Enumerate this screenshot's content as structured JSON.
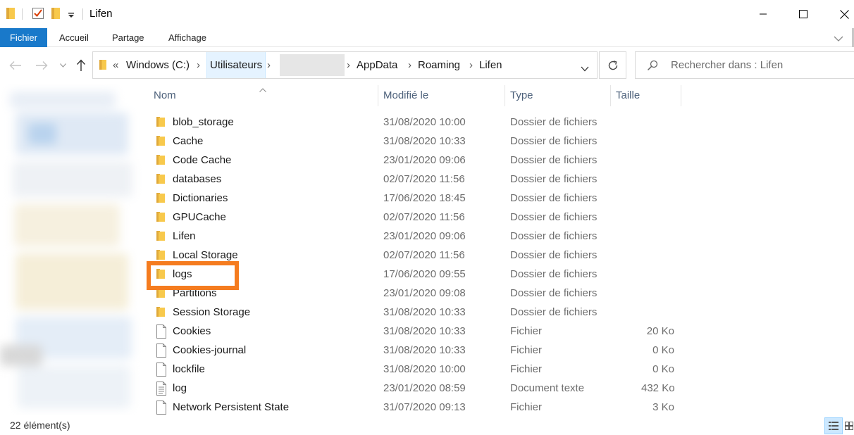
{
  "window": {
    "title": "Lifen",
    "minimize_glyph": "—",
    "maximize_glyph": "☐",
    "close_glyph": "✕"
  },
  "ribbon": {
    "tabs": [
      "Fichier",
      "Accueil",
      "Partage",
      "Affichage"
    ]
  },
  "address": {
    "overflow": "«",
    "crumbs": [
      "Windows (C:)",
      "Utilisateurs",
      "AppData",
      "Roaming",
      "Lifen"
    ],
    "separator": "›"
  },
  "search": {
    "placeholder": "Rechercher dans : Lifen"
  },
  "columns": {
    "name": "Nom",
    "modified": "Modifié le",
    "type": "Type",
    "size": "Taille"
  },
  "files": [
    {
      "name": "blob_storage",
      "date": "31/08/2020 10:00",
      "type": "Dossier de fichiers",
      "size": "",
      "icon": "folder-icon"
    },
    {
      "name": "Cache",
      "date": "31/08/2020 10:33",
      "type": "Dossier de fichiers",
      "size": "",
      "icon": "folder-icon"
    },
    {
      "name": "Code Cache",
      "date": "23/01/2020 09:06",
      "type": "Dossier de fichiers",
      "size": "",
      "icon": "folder-icon"
    },
    {
      "name": "databases",
      "date": "02/07/2020 11:56",
      "type": "Dossier de fichiers",
      "size": "",
      "icon": "folder-icon"
    },
    {
      "name": "Dictionaries",
      "date": "17/06/2020 18:45",
      "type": "Dossier de fichiers",
      "size": "",
      "icon": "folder-icon"
    },
    {
      "name": "GPUCache",
      "date": "02/07/2020 11:56",
      "type": "Dossier de fichiers",
      "size": "",
      "icon": "folder-icon"
    },
    {
      "name": "Lifen",
      "date": "23/01/2020 09:06",
      "type": "Dossier de fichiers",
      "size": "",
      "icon": "folder-icon"
    },
    {
      "name": "Local Storage",
      "date": "02/07/2020 11:56",
      "type": "Dossier de fichiers",
      "size": "",
      "icon": "folder-icon"
    },
    {
      "name": "logs",
      "date": "17/06/2020 09:55",
      "type": "Dossier de fichiers",
      "size": "",
      "icon": "folder-icon"
    },
    {
      "name": "Partitions",
      "date": "23/01/2020 09:08",
      "type": "Dossier de fichiers",
      "size": "",
      "icon": "folder-icon"
    },
    {
      "name": "Session Storage",
      "date": "31/08/2020 10:33",
      "type": "Dossier de fichiers",
      "size": "",
      "icon": "folder-icon"
    },
    {
      "name": "Cookies",
      "date": "31/08/2020 10:33",
      "type": "Fichier",
      "size": "20 Ko",
      "icon": "file-icon"
    },
    {
      "name": "Cookies-journal",
      "date": "31/08/2020 10:33",
      "type": "Fichier",
      "size": "0 Ko",
      "icon": "file-icon"
    },
    {
      "name": "lockfile",
      "date": "31/08/2020 10:00",
      "type": "Fichier",
      "size": "0 Ko",
      "icon": "file-icon"
    },
    {
      "name": "log",
      "date": "23/01/2020 08:59",
      "type": "Document texte",
      "size": "432 Ko",
      "icon": "text-file-icon"
    },
    {
      "name": "Network Persistent State",
      "date": "31/07/2020 09:13",
      "type": "Fichier",
      "size": "3 Ko",
      "icon": "file-icon"
    }
  ],
  "status": {
    "count": "22 élément(s)"
  },
  "colors": {
    "accent": "#1979ca",
    "folder": "#f8c94c",
    "highlight_box": "#f57c1f"
  }
}
